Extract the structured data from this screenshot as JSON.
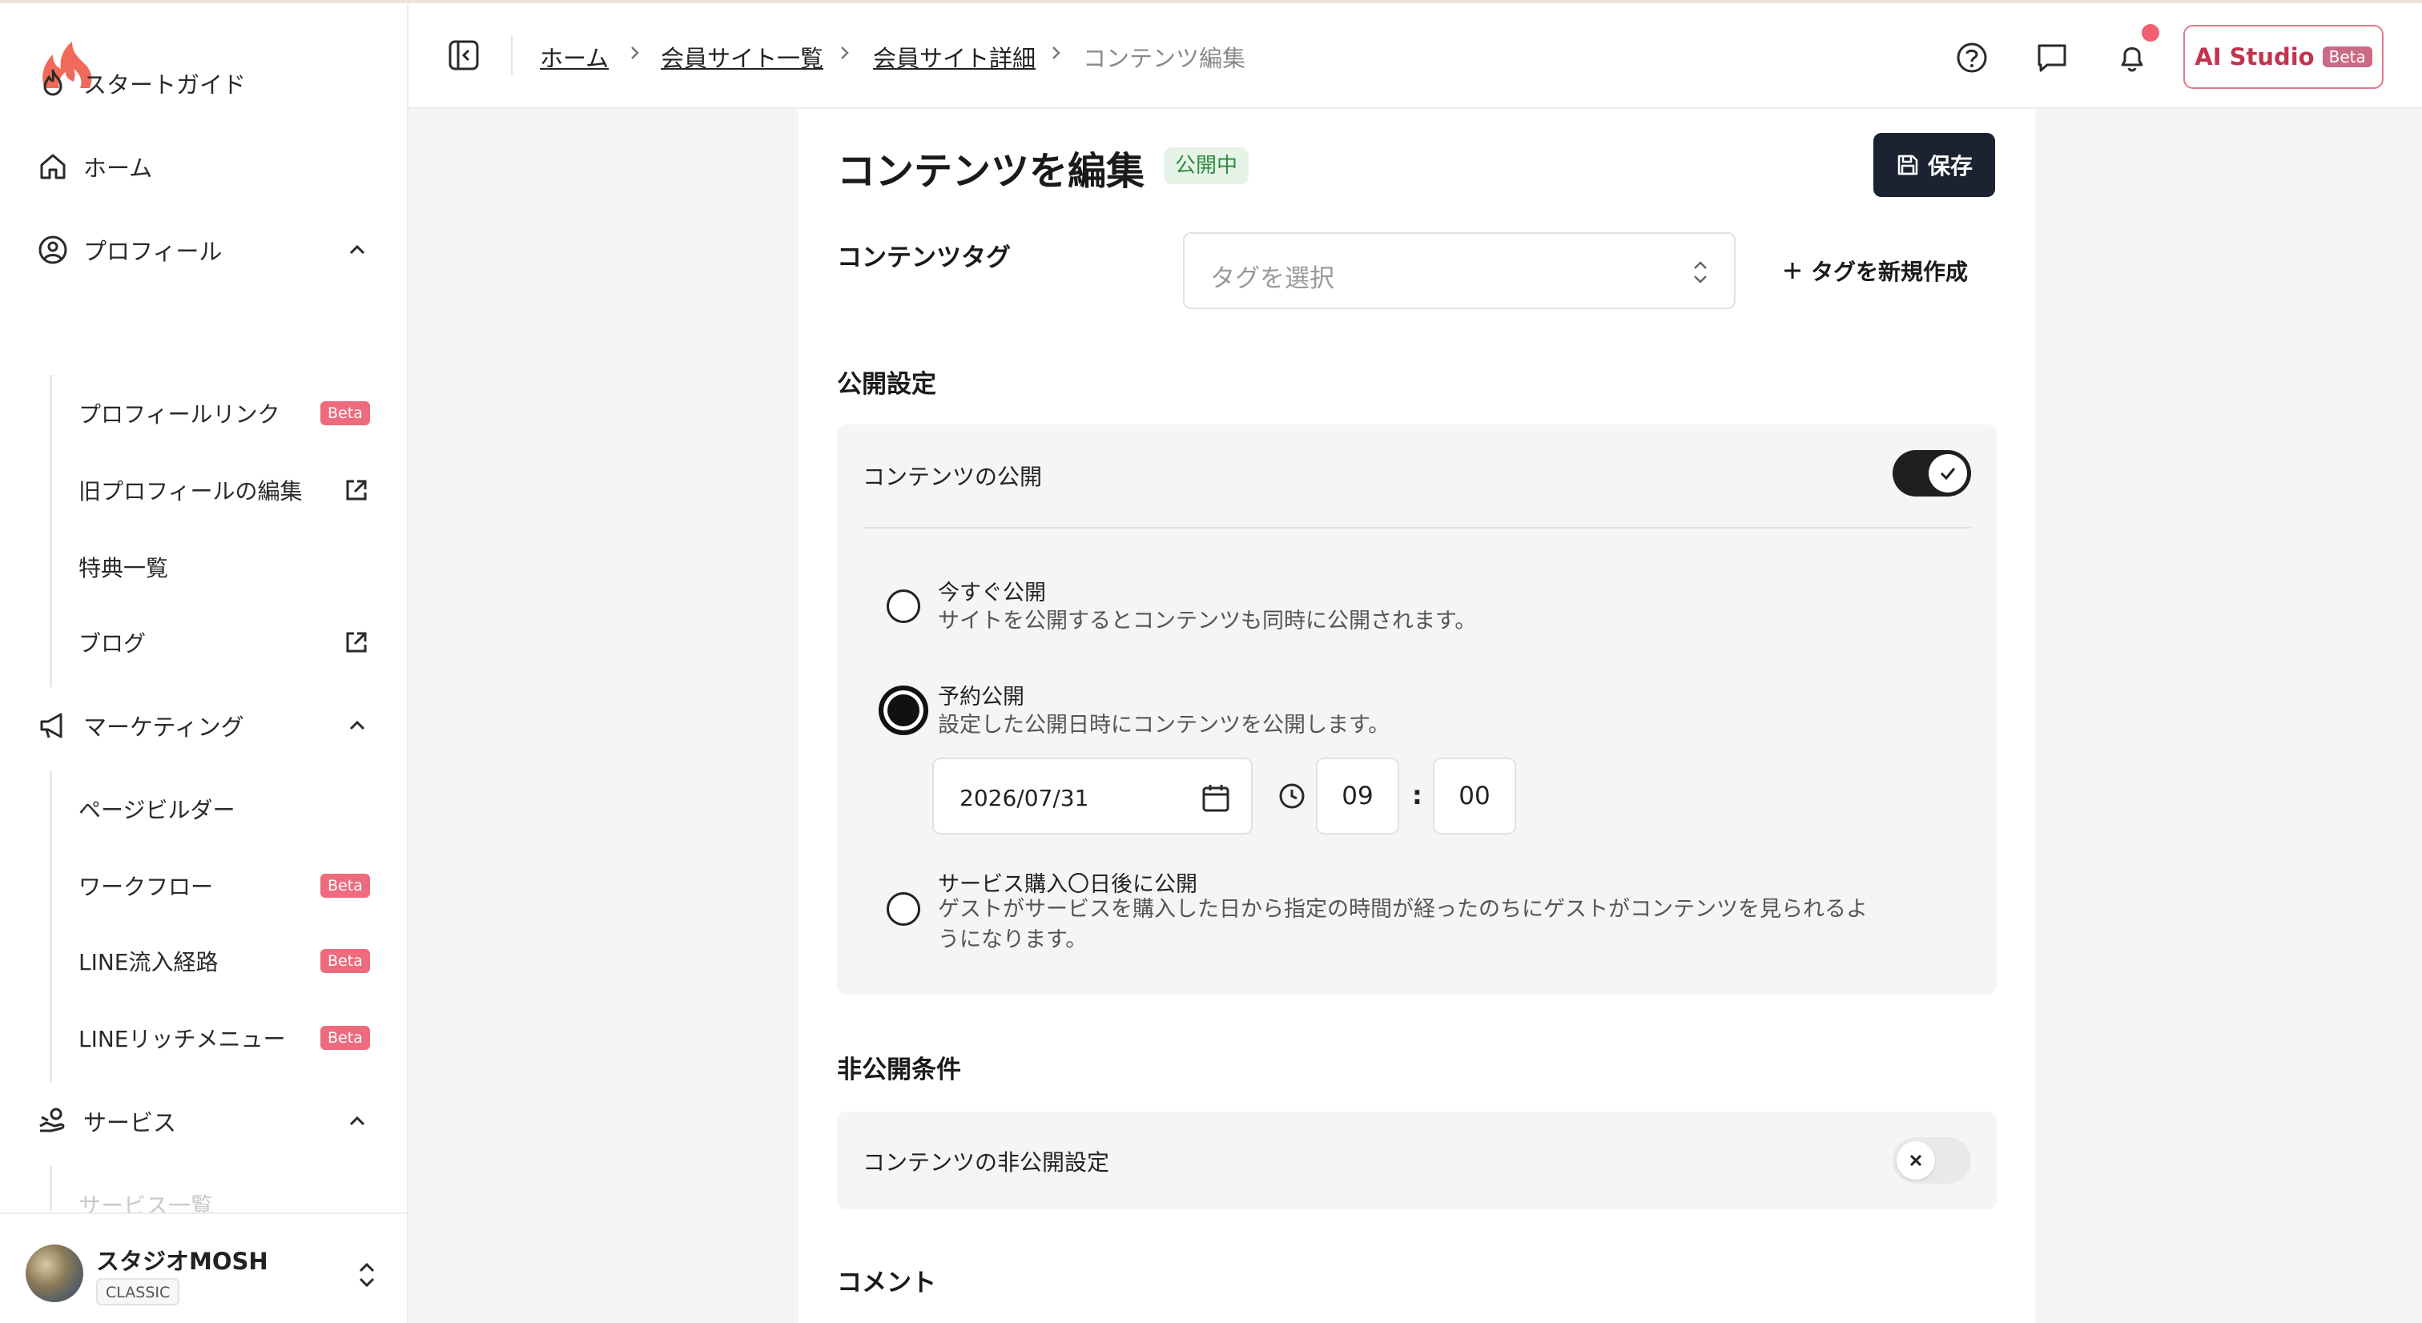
{
  "sidebar": {
    "items": {
      "start_guide": "スタートガイド",
      "home": "ホーム",
      "profile": "プロフィール",
      "marketing": "マーケティング",
      "service": "サービス"
    },
    "profile_sub": [
      {
        "label": "プロフィールリンク",
        "badge": "Beta"
      },
      {
        "label": "旧プロフィールの編集"
      },
      {
        "label": "特典一覧"
      },
      {
        "label": "ブログ"
      }
    ],
    "marketing_sub": [
      {
        "label": "ページビルダー"
      },
      {
        "label": "ワークフロー",
        "badge": "Beta"
      },
      {
        "label": "LINE流入経路",
        "badge": "Beta"
      },
      {
        "label": "LINEリッチメニュー",
        "badge": "Beta"
      }
    ],
    "service_sub_partial": "サービス一覧",
    "account": {
      "name": "スタジオMOSH",
      "plan": "CLASSIC"
    }
  },
  "header": {
    "breadcrumb": [
      "ホーム",
      "会員サイト一覧",
      "会員サイト詳細",
      "コンテンツ編集"
    ],
    "ai_studio": {
      "label": "AI Studio",
      "badge": "Beta"
    },
    "notification_dot_color": "#f06070"
  },
  "main": {
    "title": "コンテンツを編集",
    "status": "公開中",
    "save_label": "保存",
    "tag_section": {
      "label": "コンテンツタグ",
      "placeholder": "タグを選択",
      "new_tag_label": "タグを新規作成"
    },
    "publish_section": {
      "label": "公開設定",
      "toggle_label": "コンテンツの公開",
      "toggle_on": true,
      "options": [
        {
          "title": "今すぐ公開",
          "desc": "サイトを公開するとコンテンツも同時に公開されます。",
          "selected": false
        },
        {
          "title": "予約公開",
          "desc": "設定した公開日時にコンテンツを公開します。",
          "selected": true
        },
        {
          "title": "サービス購入〇日後に公開",
          "desc_line1": "ゲストがサービスを購入した日から指定の時間が経ったのちにゲストがコンテンツを見られるよ",
          "desc_line2": "うになります。",
          "selected": false
        }
      ],
      "schedule": {
        "date": "2026/07/31",
        "hour": "09",
        "minute": "00",
        "separator": ":"
      }
    },
    "unpublish_section": {
      "label": "非公開条件",
      "toggle_label": "コンテンツの非公開設定",
      "toggle_on": false
    },
    "comment_section": {
      "label": "コメント"
    }
  },
  "colors": {
    "brand": "#f06a5a",
    "badge": "#ee6b7d",
    "primary_button": "#1b2232",
    "status_green": "#2f8a3c"
  }
}
